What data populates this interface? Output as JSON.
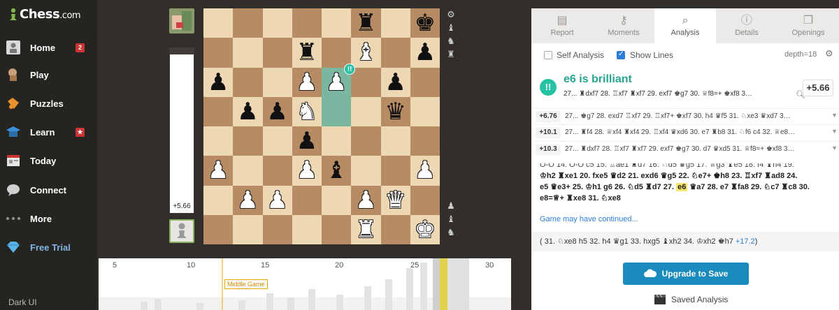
{
  "brand": {
    "name": "Chess",
    "suffix": ".com"
  },
  "sidebar": {
    "items": [
      {
        "label": "Home",
        "badge": "2"
      },
      {
        "label": "Play"
      },
      {
        "label": "Puzzles"
      },
      {
        "label": "Learn",
        "badge": "★"
      },
      {
        "label": "Today"
      },
      {
        "label": "Connect"
      },
      {
        "label": "More"
      },
      {
        "label": "Free Trial"
      }
    ],
    "dark_ui": "Dark UI"
  },
  "eval": {
    "value": "+5.66",
    "white_fraction": 0.96
  },
  "board": {
    "ranks": [
      [
        "",
        "",
        "",
        "",
        "",
        "bR",
        "",
        "bK"
      ],
      [
        "",
        "",
        "",
        "bR",
        "",
        "wB",
        "",
        "bP"
      ],
      [
        "bP",
        "",
        "",
        "wP",
        "wP!",
        "",
        "bP",
        ""
      ],
      [
        "",
        "bP",
        "bP",
        "wN",
        "hl",
        "",
        "bQ",
        ""
      ],
      [
        "",
        "",
        "",
        "bP",
        "",
        "",
        "",
        ""
      ],
      [
        "wP",
        "",
        "",
        "wP",
        "bB",
        "",
        "",
        "wP"
      ],
      [
        "",
        "wP",
        "wP",
        "",
        "",
        "wP",
        "wQ",
        ""
      ],
      [
        "",
        "",
        "",
        "",
        "",
        "wR",
        "",
        "wK"
      ]
    ],
    "brilliant_badge": "!!"
  },
  "graph": {
    "ticks": [
      "5",
      "10",
      "15",
      "20",
      "25",
      "30"
    ],
    "phase_label": "Middle Game"
  },
  "tabs": [
    "Report",
    "Moments",
    "Analysis",
    "Details",
    "Openings"
  ],
  "options": {
    "self_analysis": "Self Analysis",
    "show_lines": "Show Lines",
    "depth": "depth=18"
  },
  "brilliant": {
    "icon": "!!",
    "move": "e6",
    "title_suffix": " is brilliant",
    "line": "27... ♜dxf7 28. ♖xf7 ♜xf7 29. exf7 ♚g7 30. ♕f8=+ ♚xf8 3…",
    "eval": "+5.66"
  },
  "lines": [
    {
      "eval": "+6.76",
      "moves": "27... ♚g7 28. exd7 ♖xf7 29. ♖xf7+ ♚xf7 30. h4 ♛f5 31. ♘xe3 ♛xd7 3…"
    },
    {
      "eval": "+10.1",
      "moves": "27... ♜f4 28. ♕xf4 ♜xf4 29. ♖xf4 ♛xd6 30. e7 ♜b8 31. ♘f6 c4 32. ♕e8…"
    },
    {
      "eval": "+10.3",
      "moves": "27... ♜dxf7 28. ♖xf7 ♜xf7 29. exf7 ♚g7 30. d7 ♛xd5 31. ♕f8=+ ♚xf8 3…"
    }
  ],
  "move_text": {
    "l1": "O-O 14. O-O c5 15. ♖ae1 ♜d7 16. ♘d5 ♛g5 17. ♕g3 ♝e5 18. f4 ♝h4 19.",
    "l2": "♔h2 ♜xe1 20. fxe5 ♛d2 21. exd6 ♛g5 22. ♘e7+ ♚h8 23. ♖xf7 ♜ad8 24.",
    "l3a": "e5 ♛e3+ 25. ♔h1 g6 26. ♘d5 ♜d7 27.",
    "current": "e6",
    "l3b": "♛a7 28. e7 ♜fa8 29. ♘c7 ♜c8 30.",
    "l4": "e8=♕+ ♜xe8 31. ♘xe8"
  },
  "continued": "Game may have continued...",
  "variation": {
    "text": "( 31. ♘xe8 h5 32. h4 ♛g1 33. hxg5 ♝xh2 34. ♔xh2 ♚h7 ",
    "plus": "+17.2",
    "close": ")"
  },
  "upgrade": "Upgrade to Save",
  "saved_analysis": "Saved Analysis"
}
